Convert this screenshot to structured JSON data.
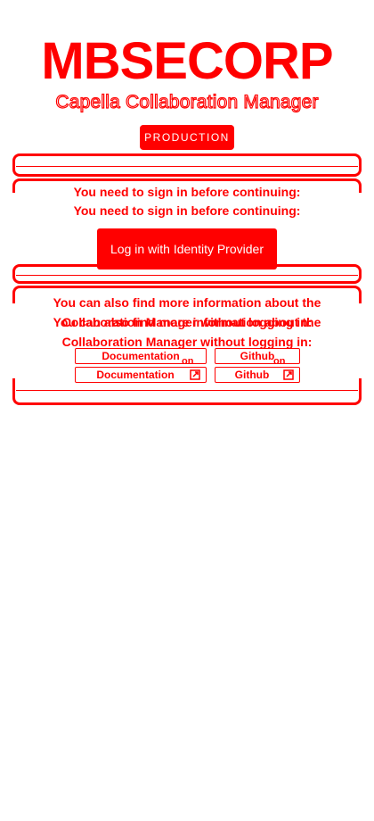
{
  "brand": {
    "title": "MBSECORP",
    "subtitle": "Capella Collaboration Manager"
  },
  "environment": {
    "badge": "PRODUCTION"
  },
  "login": {
    "message": "You need to sign in before continuing:",
    "button_label": "Log in with Identity Provider"
  },
  "info": {
    "text_line1": "You can also find more information about the",
    "text_line2": "Collaboration Manager without logging in:"
  },
  "links": {
    "documentation": {
      "label": "Documentation",
      "suffix": "on"
    },
    "github": {
      "label": "Github",
      "suffix": "on"
    }
  },
  "colors": {
    "accent": "#ff0000",
    "background": "#ffffff"
  },
  "icons": {
    "external": "open-in-new-icon"
  }
}
